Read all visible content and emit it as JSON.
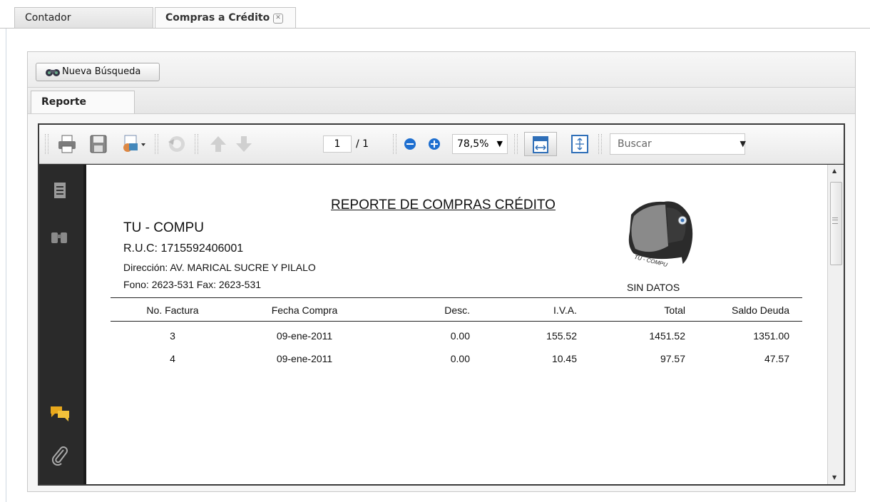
{
  "tabs": [
    {
      "label": "Contador"
    },
    {
      "label": "Compras a Crédito",
      "close": "✕"
    }
  ],
  "search": {
    "new_search_label": "Nueva Búsqueda"
  },
  "report_tab": {
    "label": "Reporte"
  },
  "viewer": {
    "page_current": "1",
    "page_total": "/ 1",
    "zoom": "78,5%",
    "find_placeholder": "Buscar",
    "icons": [
      "print-icon",
      "save-icon",
      "pdf-export-icon",
      "refresh-icon",
      "arrow-up-icon",
      "arrow-down-icon",
      "zoom-out-icon",
      "zoom-in-icon",
      "fit-width-icon",
      "fit-page-icon"
    ]
  },
  "report": {
    "title": "REPORTE DE COMPRAS CRÉDITO",
    "company": "TU - COMPU",
    "ruc": "R.U.C: 1715592406001",
    "address": "Dirección: AV. MARICAL SUCRE Y PILALO",
    "phone": "Fono: 2623-531 Fax: 2623-531",
    "logo_text": "TU - COMPU",
    "status": "SIN DATOS",
    "columns": [
      "No. Factura",
      "Fecha Compra",
      "Desc.",
      "I.V.A.",
      "Total",
      "Saldo Deuda"
    ],
    "rows": [
      [
        "3",
        "09-ene-2011",
        "0.00",
        "155.52",
        "1451.52",
        "1351.00"
      ],
      [
        "4",
        "09-ene-2011",
        "0.00",
        "10.45",
        "97.57",
        "47.57"
      ]
    ]
  }
}
